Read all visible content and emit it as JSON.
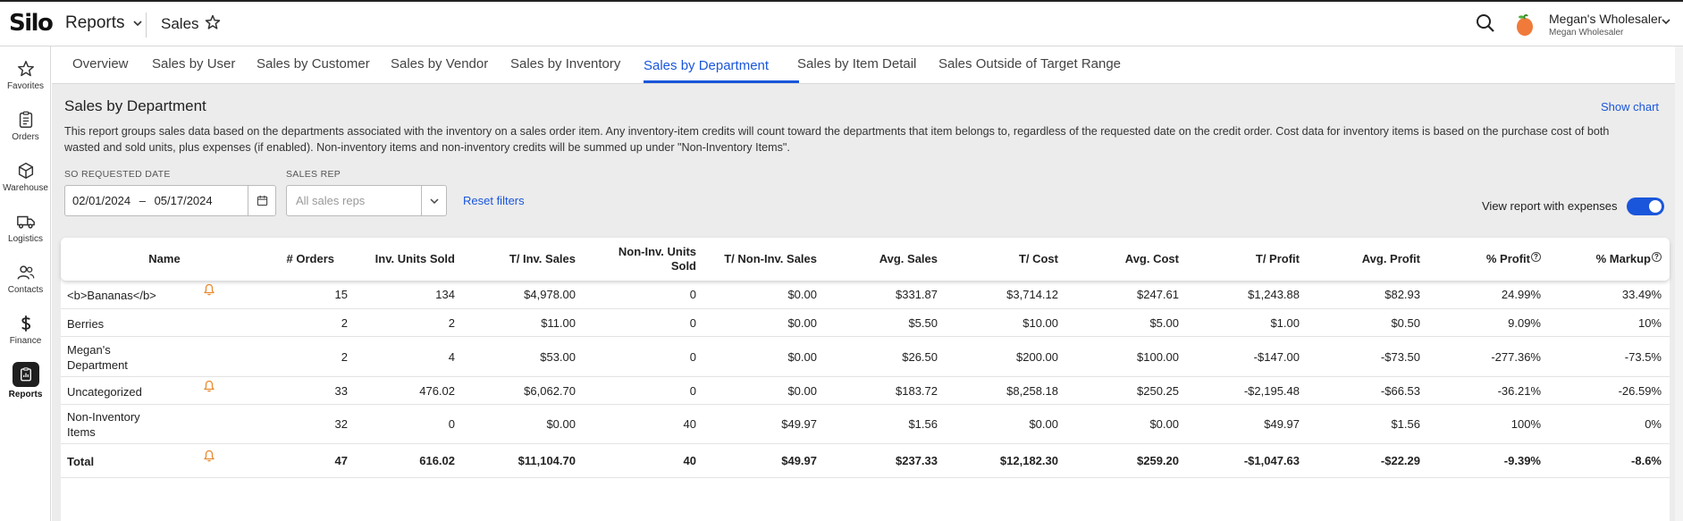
{
  "app": {
    "logo": "Silo",
    "menu_label": "Reports",
    "page_crumb": "Sales"
  },
  "user": {
    "company": "Megan's Wholesaler",
    "org": "Megan Wholesaler"
  },
  "nav": [
    {
      "label": "Favorites",
      "icon": "star-icon"
    },
    {
      "label": "Orders",
      "icon": "clipboard-icon"
    },
    {
      "label": "Warehouse",
      "icon": "cube-icon"
    },
    {
      "label": "Logistics",
      "icon": "truck-icon"
    },
    {
      "label": "Contacts",
      "icon": "people-icon"
    },
    {
      "label": "Finance",
      "icon": "dollar-icon"
    },
    {
      "label": "Reports",
      "icon": "report-icon",
      "active": true
    }
  ],
  "tabs": [
    "Overview",
    "Sales by User",
    "Sales by Customer",
    "Sales by Vendor",
    "Sales by Inventory",
    "Sales by Department",
    "Sales by Item Detail",
    "Sales Outside of Target Range"
  ],
  "active_tab": "Sales by Department",
  "report": {
    "title": "Sales by Department",
    "show_chart": "Show chart",
    "description": "This report groups sales data based on the departments associated with the inventory on a sales order item. Any inventory-item credits will count toward the departments that item belongs to, regardless of the requested date on the credit order. Cost data for inventory items is based on the purchase cost of both wasted and sold units, plus expenses (if enabled). Non-inventory items and non-inventory credits will be summed up under \"Non-Inventory Items\"."
  },
  "filters": {
    "date_label": "SO REQUESTED DATE",
    "date_start": "02/01/2024",
    "date_sep": "–",
    "date_end": "05/17/2024",
    "rep_label": "SALES REP",
    "rep_placeholder": "All sales reps",
    "reset": "Reset filters",
    "expenses_label": "View report with expenses",
    "expenses_on": true
  },
  "table": {
    "columns": [
      {
        "label": "Name"
      },
      {
        "label": "# Orders"
      },
      {
        "label": "Inv. Units Sold"
      },
      {
        "label": "T/ Inv. Sales"
      },
      {
        "label_line1": "Non-Inv. Units",
        "label_line2": "Sold"
      },
      {
        "label": "T/ Non-Inv. Sales"
      },
      {
        "label": "Avg. Sales"
      },
      {
        "label": "T/ Cost"
      },
      {
        "label": "Avg. Cost"
      },
      {
        "label": "T/ Profit"
      },
      {
        "label": "Avg. Profit"
      },
      {
        "label": "% Profit",
        "help": true
      },
      {
        "label": "% Markup",
        "help": true
      }
    ],
    "rows": [
      {
        "name_line1": "<b>Bananas</b>",
        "name_line2": "",
        "bell": true,
        "values": [
          "15",
          "134",
          "$4,978.00",
          "0",
          "$0.00",
          "$331.87",
          "$3,714.12",
          "$247.61",
          "$1,243.88",
          "$82.93",
          "24.99%",
          "33.49%"
        ]
      },
      {
        "name_line1": "Berries",
        "name_line2": "",
        "bell": false,
        "values": [
          "2",
          "2",
          "$11.00",
          "0",
          "$0.00",
          "$5.50",
          "$10.00",
          "$5.00",
          "$1.00",
          "$0.50",
          "9.09%",
          "10%"
        ]
      },
      {
        "name_line1": "Megan's",
        "name_line2": "Department",
        "bell": false,
        "values": [
          "2",
          "4",
          "$53.00",
          "0",
          "$0.00",
          "$26.50",
          "$200.00",
          "$100.00",
          "-$147.00",
          "-$73.50",
          "-277.36%",
          "-73.5%"
        ]
      },
      {
        "name_line1": "Uncategorized",
        "name_line2": "",
        "bell": true,
        "values": [
          "33",
          "476.02",
          "$6,062.70",
          "0",
          "$0.00",
          "$183.72",
          "$8,258.18",
          "$250.25",
          "-$2,195.48",
          "-$66.53",
          "-36.21%",
          "-26.59%"
        ]
      },
      {
        "name_line1": "Non-Inventory",
        "name_line2": "Items",
        "bell": false,
        "values": [
          "32",
          "0",
          "$0.00",
          "40",
          "$49.97",
          "$1.56",
          "$0.00",
          "$0.00",
          "$49.97",
          "$1.56",
          "100%",
          "0%"
        ]
      }
    ],
    "total": {
      "name": "Total",
      "bell": true,
      "values": [
        "47",
        "616.02",
        "$11,104.70",
        "40",
        "$49.97",
        "$237.33",
        "$12,182.30",
        "$259.20",
        "-$1,047.63",
        "-$22.29",
        "-9.39%",
        "-8.6%"
      ]
    }
  },
  "colors": {
    "accent": "#1a56db",
    "bell": "#e8892e",
    "background": "#ececec"
  }
}
